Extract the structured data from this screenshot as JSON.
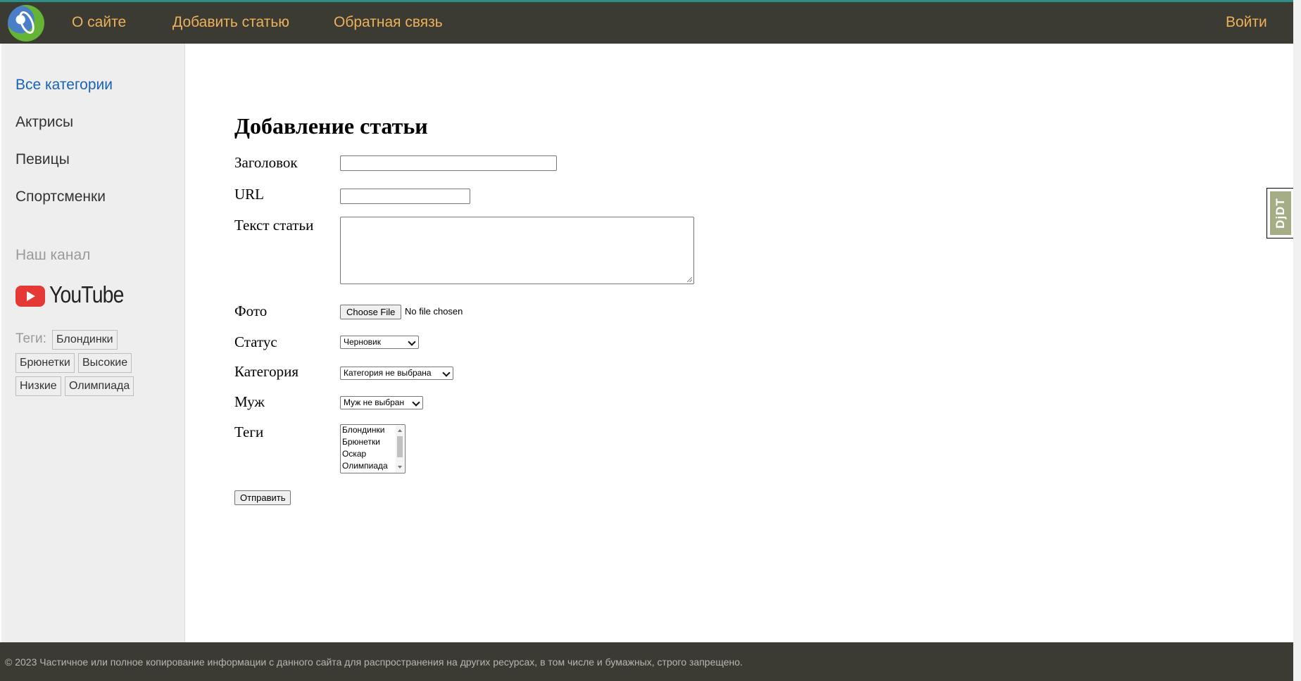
{
  "header": {
    "nav": [
      "О сайте",
      "Добавить статью",
      "Обратная связь"
    ],
    "login": "Войти"
  },
  "sidebar": {
    "categories": [
      "Все категории",
      "Актрисы",
      "Певицы",
      "Спортсменки"
    ],
    "channel_label": "Наш канал",
    "youtube_label": "YouTube",
    "tags_label": "Теги:",
    "tags": [
      "Блондинки",
      "Брюнетки",
      "Высокие",
      "Низкие",
      "Олимпиада"
    ]
  },
  "form": {
    "title": "Добавление статьи",
    "labels": {
      "heading": "Заголовок",
      "url": "URL",
      "text": "Текст статьи",
      "photo": "Фото",
      "status": "Статус",
      "category": "Категория",
      "husband": "Муж",
      "tags": "Теги"
    },
    "file_button": "Choose File",
    "file_status": "No file chosen",
    "status_value": "Черновик",
    "category_value": "Категория не выбрана",
    "husband_value": "Муж не выбран",
    "tag_options": [
      "Блондинки",
      "Брюнетки",
      "Оскар",
      "Олимпиада"
    ],
    "submit": "Отправить"
  },
  "footer": {
    "text": "© 2023 Частичное или полное копирование информации с данного сайта для распространения на других ресурсах, в том числе и бумажных, строго запрещено."
  },
  "debug_toolbar": {
    "label": "DjDT"
  },
  "colors": {
    "header_bg": "#3b3a33",
    "nav_link": "#ecb15a",
    "active_link": "#1963b5"
  }
}
